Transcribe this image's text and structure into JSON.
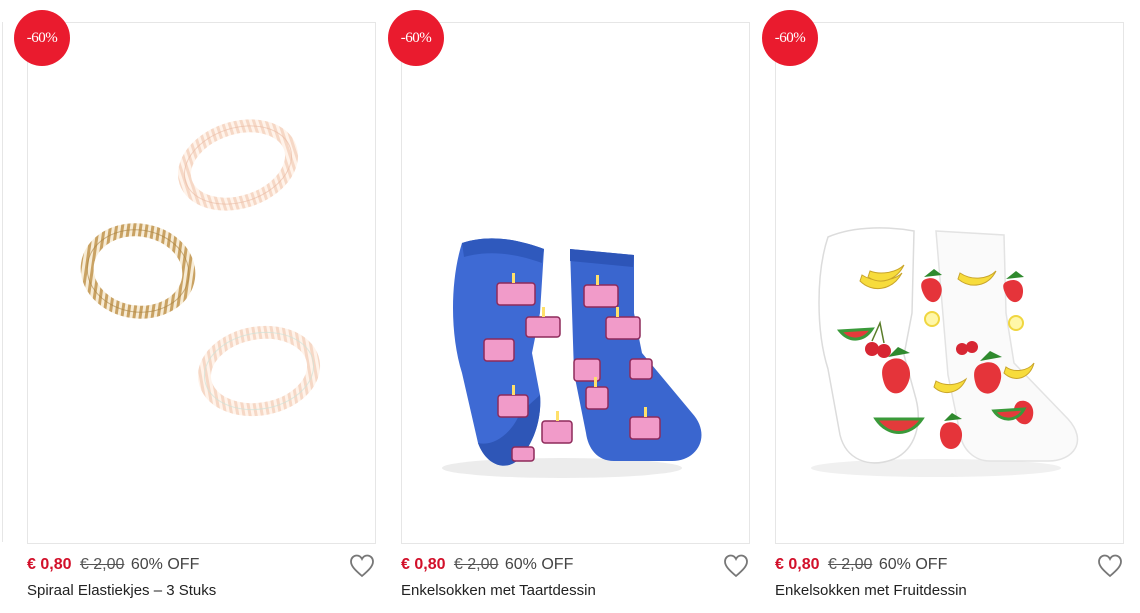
{
  "products": [
    {
      "badge": "-60%",
      "price_now": "€ 0,80",
      "price_old": "€ 2,00",
      "discount": "60% OFF",
      "title": "Spiraal Elastiekjes – 3 Stuks",
      "image_icon": "hair-spiral-icon"
    },
    {
      "badge": "-60%",
      "price_now": "€ 0,80",
      "price_old": "€ 2,00",
      "discount": "60% OFF",
      "title": "Enkelsokken met Taartdessin",
      "image_icon": "cake-socks-icon"
    },
    {
      "badge": "-60%",
      "price_now": "€ 0,80",
      "price_old": "€ 2,00",
      "discount": "60% OFF",
      "title": "Enkelsokken met Fruitdessin",
      "image_icon": "fruit-socks-icon"
    }
  ],
  "colors": {
    "badge": "#ea1b2e",
    "price_now": "#d2102a",
    "border": "#e6e6e6"
  }
}
